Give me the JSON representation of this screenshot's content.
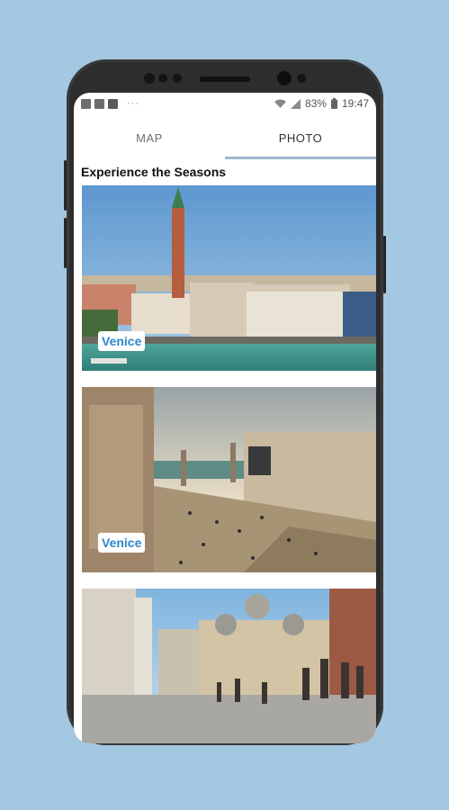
{
  "status_bar": {
    "battery": "83%",
    "time": "19:47",
    "dots": "···"
  },
  "tabs": [
    {
      "label": "MAP",
      "active": false
    },
    {
      "label": "PHOTO",
      "active": true
    }
  ],
  "section_title": "Experience the Seasons",
  "cards": [
    {
      "label": "Venice"
    },
    {
      "label": "Venice"
    },
    {
      "label": ""
    }
  ],
  "colors": {
    "background": "#a4c8e1",
    "tab_indicator": "#9fb7cf",
    "card_label_text": "#2e86c9"
  }
}
